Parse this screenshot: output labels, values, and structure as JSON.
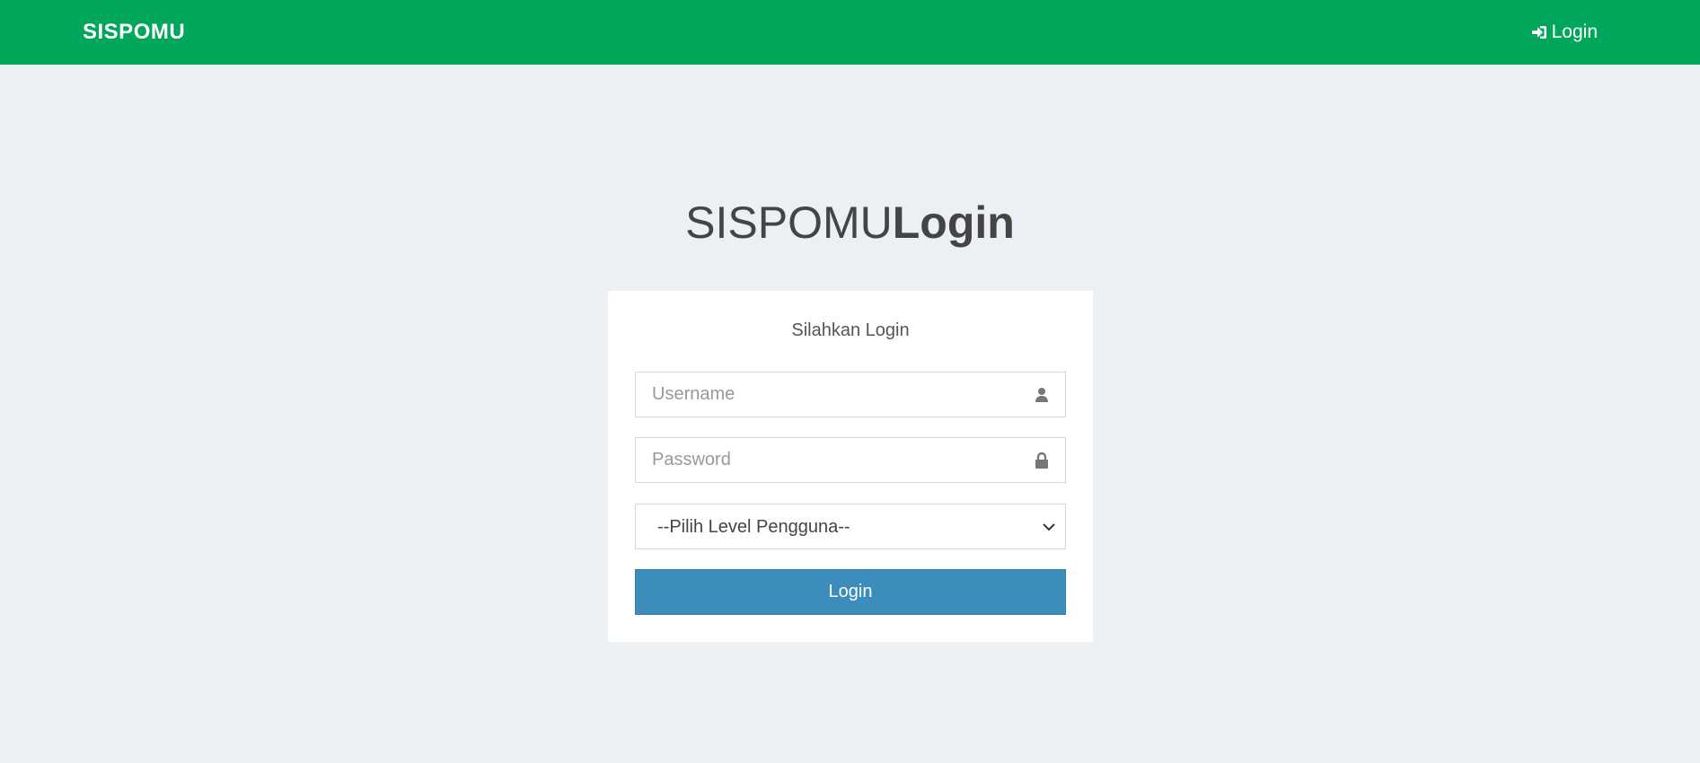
{
  "navbar": {
    "brand": "SISPOMU",
    "login_label": "Login",
    "login_icon": "sign-in-icon",
    "color": "#00a65a"
  },
  "logo": {
    "light_text": "SISPOMU",
    "bold_text": "Login"
  },
  "login_box": {
    "message": "Silahkan Login",
    "username": {
      "placeholder": "Username",
      "value": "",
      "icon": "user-icon"
    },
    "password": {
      "placeholder": "Password",
      "value": "",
      "icon": "lock-icon"
    },
    "level_select": {
      "selected": "--Pilih Level Pengguna--",
      "icon": "chevron-down-icon"
    },
    "submit_label": "Login",
    "submit_color": "#3c8dbc"
  },
  "background_color": "#ecf0f5"
}
